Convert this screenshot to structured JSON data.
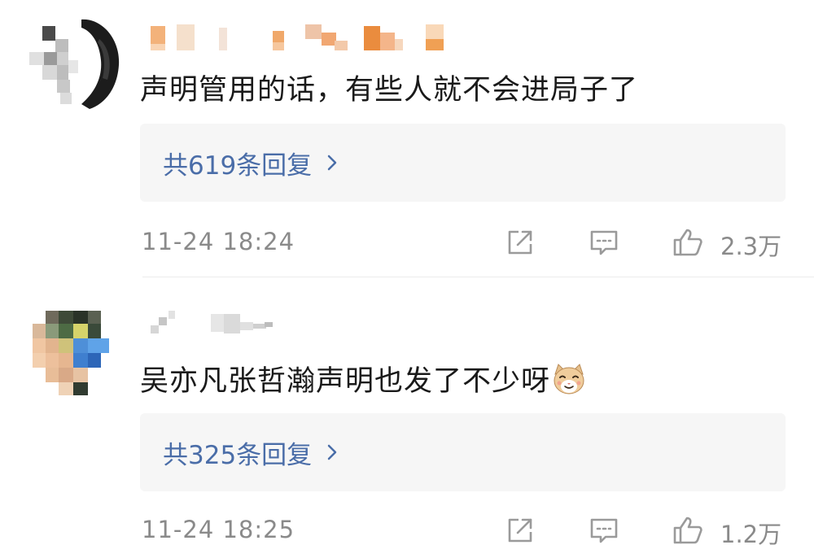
{
  "comments": [
    {
      "text": "声明管用的话，有些人就不会进局子了",
      "replies_label": "共619条回复",
      "time": "11-24 18:24",
      "likes": "2.3万"
    },
    {
      "text": "吴亦凡张哲瀚声明也发了不少呀",
      "emoji": "cat-face-emoji",
      "replies_label": "共325条回复",
      "time": "11-24 18:25",
      "likes": "1.2万"
    }
  ],
  "colors": {
    "reply_link": "#4a6da8",
    "meta_text": "#8a8a8a",
    "reply_box_bg": "#f6f6f6"
  },
  "icons": [
    "share-icon",
    "comment-icon",
    "like-icon",
    "chevron-right-icon"
  ]
}
